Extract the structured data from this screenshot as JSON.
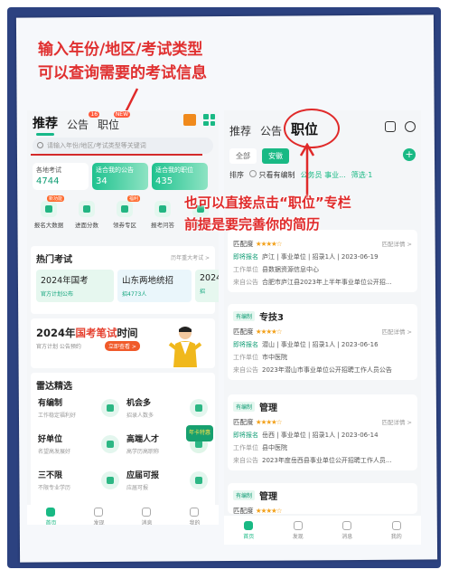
{
  "annotations": {
    "top_line1": "输入年份/地区/考试类型",
    "top_line2": "可以查询需要的考试信息",
    "right_line1": "也可以直接点击“职位”专栏",
    "right_line2": "前提是要完善你的简历"
  },
  "left": {
    "tabs": [
      {
        "label": "推荐",
        "active": true
      },
      {
        "label": "公告",
        "badge": "16"
      },
      {
        "label": "职位",
        "badge": "NEW"
      }
    ],
    "search_placeholder": "请输入年份/地区/考试类型等关键词",
    "stats": [
      {
        "label": "各地考试",
        "value": "4744"
      },
      {
        "label": "适合我的公告",
        "value": "34"
      },
      {
        "label": "适合我的职位",
        "value": "435"
      }
    ],
    "quick": [
      {
        "label": "报名大数据",
        "tag": "新功能"
      },
      {
        "label": "进面分数",
        "tag": ""
      },
      {
        "label": "领券专区",
        "tag": "福利"
      },
      {
        "label": "报考问答",
        "tag": ""
      },
      {
        "label": "专辑",
        "tag": ""
      }
    ],
    "hot": {
      "title": "热门考试",
      "more": "历年重大考试 >",
      "cards": [
        {
          "name": "2024年国考",
          "sub": "官方计划公布"
        },
        {
          "name": "山东两地统招",
          "sub": "招4773人"
        },
        {
          "name": "2024",
          "sub": "招"
        }
      ]
    },
    "banner": {
      "year": "2024年",
      "red": "国考笔试",
      "rest": "时间",
      "sub": "官方计划 公告预约",
      "pill": "立即查看 >"
    },
    "radar": {
      "title": "雷达精选",
      "items": [
        {
          "name": "有编制",
          "desc": "工作稳定福利好"
        },
        {
          "name": "机会多",
          "desc": "招录人数多"
        },
        {
          "name": "好单位",
          "desc": "名望高发展好"
        },
        {
          "name": "高端人才",
          "desc": "高学历高职称"
        },
        {
          "name": "三不限",
          "desc": "不限专业学历"
        },
        {
          "name": "应届可报",
          "desc": "应届可报"
        }
      ],
      "promo": "年卡特惠"
    },
    "nav": [
      {
        "label": "首页",
        "active": true
      },
      {
        "label": "发现"
      },
      {
        "label": "消息"
      },
      {
        "label": "我的"
      }
    ]
  },
  "right": {
    "tabs": [
      {
        "label": "推荐"
      },
      {
        "label": "公告"
      },
      {
        "label": "职位",
        "active": true
      }
    ],
    "chips": [
      {
        "label": "全部"
      },
      {
        "label": "安徽",
        "active": true
      }
    ],
    "filter": {
      "sort": "排序",
      "only": "只看有编制",
      "type": "公务员 事业...",
      "screen": "筛选·1"
    },
    "jobs": [
      {
        "tag": "",
        "title": "",
        "match_label": "匹配度",
        "detail": "匹配详情 >",
        "row1": {
          "k": "即将报名",
          "v": "庐江 | 事业单位 | 招录1人 | 2023-06-19"
        },
        "row2": {
          "k": "工作单位",
          "v": "县数据资源信息中心"
        },
        "row3": {
          "k": "来自公告",
          "v": "合肥市庐江县2023年上半年事业单位公开招..."
        }
      },
      {
        "tag": "有编制",
        "title": "专技3",
        "match_label": "匹配度",
        "detail": "匹配详情 >",
        "row1": {
          "k": "即将报名",
          "v": "潜山 | 事业单位 | 招录1人 | 2023-06-16"
        },
        "row2": {
          "k": "工作单位",
          "v": "市中医院"
        },
        "row3": {
          "k": "来自公告",
          "v": "2023年潜山市事业单位公开招聘工作人员公告"
        }
      },
      {
        "tag": "有编制",
        "title": "管理",
        "match_label": "匹配度",
        "detail": "匹配详情 >",
        "row1": {
          "k": "即将报名",
          "v": "岳西 | 事业单位 | 招录1人 | 2023-06-14"
        },
        "row2": {
          "k": "工作单位",
          "v": "县中医院"
        },
        "row3": {
          "k": "来自公告",
          "v": "2023年度岳西县事业单位公开招聘工作人员..."
        }
      },
      {
        "tag": "有编制",
        "title": "管理",
        "match_label": "匹配度",
        "detail": "",
        "row1": {
          "k": "",
          "v": ""
        },
        "row2": {
          "k": "",
          "v": ""
        },
        "row3": {
          "k": "",
          "v": ""
        }
      }
    ],
    "nav": [
      {
        "label": "首页",
        "active": true
      },
      {
        "label": "发现"
      },
      {
        "label": "消息"
      },
      {
        "label": "我的"
      }
    ]
  },
  "colors": {
    "accent_green": "#19b984",
    "annotation_red": "#e02a2a",
    "frame_blue": "#2c4280",
    "star_orange": "#f3a11a"
  }
}
